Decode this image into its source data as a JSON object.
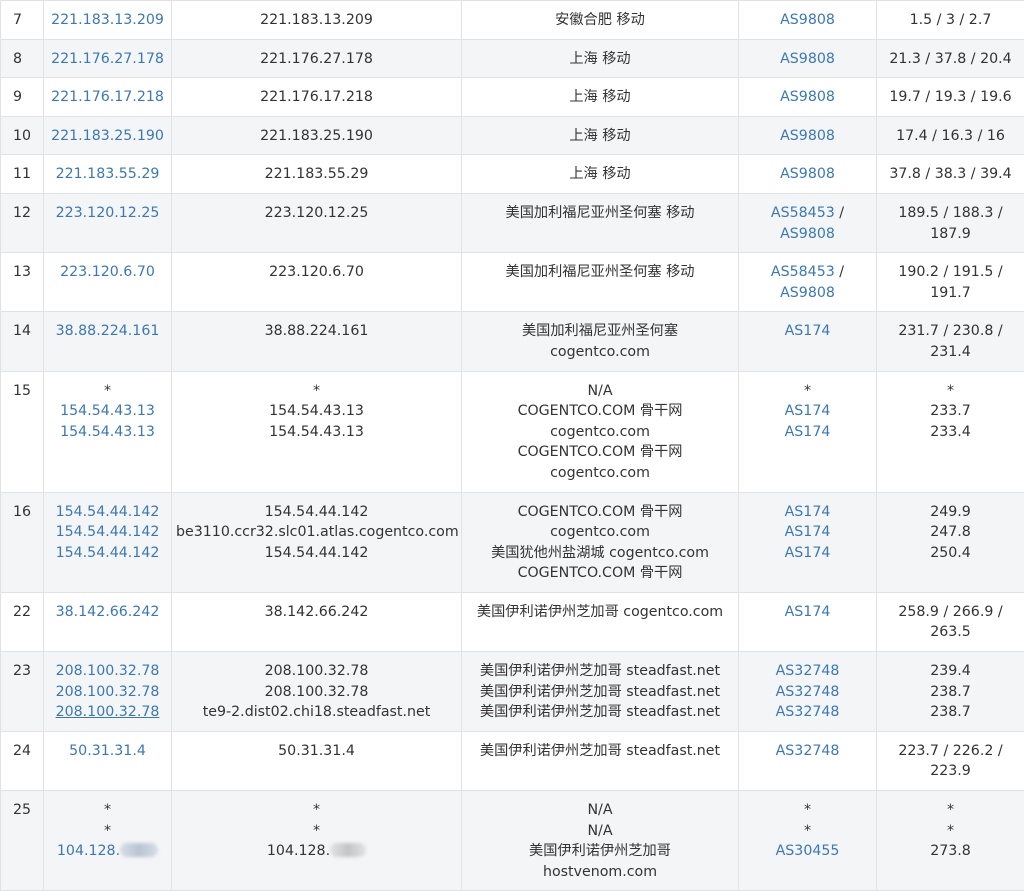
{
  "rows": [
    {
      "hop": "7",
      "ips": [
        "221.183.13.209"
      ],
      "hosts": [
        "221.183.13.209"
      ],
      "locs": [
        "安徽合肥 移动"
      ],
      "as": [
        "AS9808"
      ],
      "lat": [
        "1.5 / 3 / 2.7"
      ]
    },
    {
      "hop": "8",
      "ips": [
        "221.176.27.178"
      ],
      "hosts": [
        "221.176.27.178"
      ],
      "locs": [
        "上海 移动"
      ],
      "as": [
        "AS9808"
      ],
      "lat": [
        "21.3 / 37.8 / 20.4"
      ]
    },
    {
      "hop": "9",
      "ips": [
        "221.176.17.218"
      ],
      "hosts": [
        "221.176.17.218"
      ],
      "locs": [
        "上海 移动"
      ],
      "as": [
        "AS9808"
      ],
      "lat": [
        "19.7 / 19.3 / 19.6"
      ]
    },
    {
      "hop": "10",
      "ips": [
        "221.183.25.190"
      ],
      "hosts": [
        "221.183.25.190"
      ],
      "locs": [
        "上海 移动"
      ],
      "as": [
        "AS9808"
      ],
      "lat": [
        "17.4 / 16.3 / 16"
      ]
    },
    {
      "hop": "11",
      "ips": [
        "221.183.55.29"
      ],
      "hosts": [
        "221.183.55.29"
      ],
      "locs": [
        "上海 移动"
      ],
      "as": [
        "AS9808"
      ],
      "lat": [
        "37.8 / 38.3 / 39.4"
      ]
    },
    {
      "hop": "12",
      "ips": [
        "223.120.12.25"
      ],
      "hosts": [
        "223.120.12.25"
      ],
      "locs": [
        "美国加利福尼亚州圣何塞 移动"
      ],
      "as": [
        "AS58453",
        "AS9808"
      ],
      "as_joined": true,
      "lat": [
        "189.5 / 188.3 /",
        "187.9"
      ]
    },
    {
      "hop": "13",
      "ips": [
        "223.120.6.70"
      ],
      "hosts": [
        "223.120.6.70"
      ],
      "locs": [
        "美国加利福尼亚州圣何塞 移动"
      ],
      "as": [
        "AS58453",
        "AS9808"
      ],
      "as_joined": true,
      "lat": [
        "190.2 / 191.5 /",
        "191.7"
      ]
    },
    {
      "hop": "14",
      "ips": [
        "38.88.224.161"
      ],
      "hosts": [
        "38.88.224.161"
      ],
      "locs": [
        "美国加利福尼亚州圣何塞",
        "cogentco.com"
      ],
      "as": [
        "AS174"
      ],
      "lat": [
        "231.7 / 230.8 /",
        "231.4"
      ]
    },
    {
      "hop": "15",
      "ips": [
        "*",
        "154.54.43.13",
        "154.54.43.13"
      ],
      "hosts": [
        "*",
        "154.54.43.13",
        "154.54.43.13"
      ],
      "locs": [
        "N/A",
        "COGENTCO.COM 骨干网",
        "cogentco.com",
        "COGENTCO.COM 骨干网",
        "cogentco.com"
      ],
      "as": [
        "*",
        "AS174",
        "AS174"
      ],
      "lat": [
        "*",
        "233.7",
        "233.4"
      ]
    },
    {
      "hop": "16",
      "ips": [
        "154.54.44.142",
        "154.54.44.142",
        "154.54.44.142"
      ],
      "hosts": [
        "154.54.44.142",
        "be3110.ccr32.slc01.atlas.cogentco.com",
        "154.54.44.142"
      ],
      "locs": [
        "COGENTCO.COM 骨干网",
        "cogentco.com",
        "美国犹他州盐湖城 cogentco.com",
        "COGENTCO.COM 骨干网"
      ],
      "as": [
        "AS174",
        "AS174",
        "AS174"
      ],
      "lat": [
        "249.9",
        "247.8",
        "250.4"
      ]
    },
    {
      "hop": "22",
      "ips": [
        "38.142.66.242"
      ],
      "hosts": [
        "38.142.66.242"
      ],
      "locs": [
        "美国伊利诺伊州芝加哥 cogentco.com"
      ],
      "as": [
        "AS174"
      ],
      "lat": [
        "258.9 / 266.9 /",
        "263.5"
      ]
    },
    {
      "hop": "23",
      "ips": [
        "208.100.32.78",
        "208.100.32.78",
        "208.100.32.78"
      ],
      "hosts": [
        "208.100.32.78",
        "208.100.32.78",
        "te9-2.dist02.chi18.steadfast.net"
      ],
      "locs": [
        "美国伊利诺伊州芝加哥 steadfast.net",
        "美国伊利诺伊州芝加哥 steadfast.net",
        "美国伊利诺伊州芝加哥 steadfast.net"
      ],
      "as": [
        "AS32748",
        "AS32748",
        "AS32748"
      ],
      "lat": [
        "239.4",
        "238.7",
        "238.7"
      ]
    },
    {
      "hop": "24",
      "ips": [
        "50.31.31.4"
      ],
      "hosts": [
        "50.31.31.4"
      ],
      "locs": [
        "美国伊利诺伊州芝加哥 steadfast.net"
      ],
      "as": [
        "AS32748"
      ],
      "lat": [
        "223.7 / 226.2 /",
        "223.9"
      ]
    },
    {
      "hop": "25",
      "ips": [
        "*",
        "*",
        "104.128."
      ],
      "ips_blur_last": true,
      "hosts": [
        "*",
        "*",
        "104.128."
      ],
      "hosts_blur_last": true,
      "locs": [
        "N/A",
        "N/A",
        "美国伊利诺伊州芝加哥",
        "hostvenom.com"
      ],
      "as": [
        "*",
        "*",
        "AS30455"
      ],
      "lat": [
        "*",
        "*",
        "273.8"
      ]
    }
  ]
}
